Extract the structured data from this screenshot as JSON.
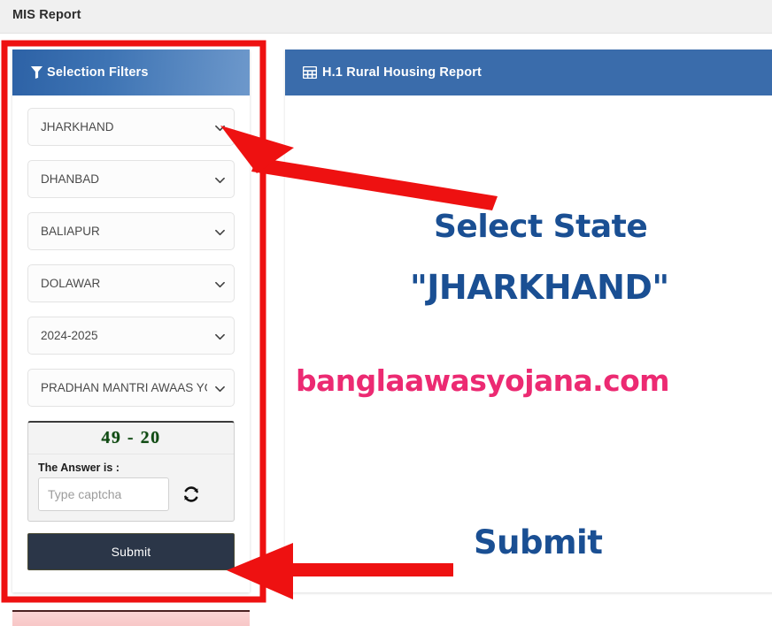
{
  "topbar": {
    "title": "MIS Report"
  },
  "filter_panel": {
    "header_label": "Selection Filters",
    "header_icon": "funnel-icon",
    "selects": [
      {
        "name": "state",
        "value": "JHARKHAND",
        "caret_icon": "chevron-down-icon"
      },
      {
        "name": "district",
        "value": "DHANBAD",
        "caret_icon": "chevron-down-icon"
      },
      {
        "name": "block",
        "value": "BALIAPUR",
        "caret_icon": "chevron-down-icon"
      },
      {
        "name": "panchayat",
        "value": "DOLAWAR",
        "caret_icon": "chevron-down-icon"
      },
      {
        "name": "year",
        "value": "2024-2025",
        "caret_icon": "chevron-down-icon"
      },
      {
        "name": "scheme",
        "value": "PRADHAN MANTRI AWAAS YOJANA",
        "caret_icon": "chevron-down-icon"
      }
    ],
    "captcha": {
      "code": "49 - 20",
      "answer_label": "The Answer is :",
      "input_value": "",
      "input_placeholder": "Type captcha",
      "refresh_icon": "refresh-icon",
      "code_color": "#0f4a12"
    },
    "submit_label": "Submit"
  },
  "report_panel": {
    "header_label": "H.1 Rural Housing Report",
    "header_icon": "table-grid-icon",
    "header_color": "#3a6cab"
  },
  "annotations": {
    "select_state": "Select State",
    "state_name": "\"JHARKHAND\"",
    "watermark": "banglaawasyojana.com",
    "submit": "Submit",
    "text_color": "#1a4f93",
    "watermark_color": "#ec2a72",
    "highlight_color": "#ee1111"
  }
}
